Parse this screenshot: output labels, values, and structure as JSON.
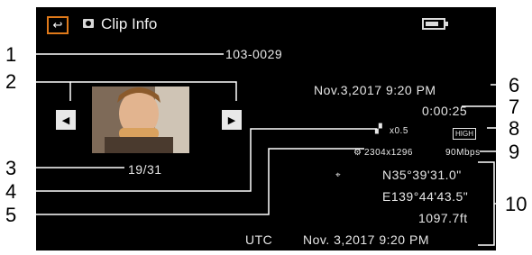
{
  "screen": {
    "title": "Clip Info",
    "icons": {
      "back": "return-arrow-icon",
      "mode": "camera-mode-icon",
      "battery": "battery-icon"
    },
    "battery_level": 0.8,
    "clip_number": "103-0029",
    "date_time": "Nov.3,2017   9:20 PM",
    "duration": "0:00:25",
    "clip_counter": "19/31",
    "zoom_ratio": "x0.5",
    "video_format": "HIGH",
    "resolution": "2304x1296",
    "bitrate": "90Mbps",
    "gps": {
      "latitude": "N35°39'31.0\"",
      "longitude": "E139°44'43.5\"",
      "altitude": "1097.7ft"
    },
    "utc_label": "UTC",
    "utc_date_time": "Nov. 3,2017   9:20 PM"
  },
  "callouts": [
    "1",
    "2",
    "3",
    "4",
    "5",
    "6",
    "7",
    "8",
    "9",
    "10"
  ],
  "colors": {
    "accent": "#e07a1a",
    "screen_bg": "#000000",
    "text": "#e6e6e6"
  }
}
